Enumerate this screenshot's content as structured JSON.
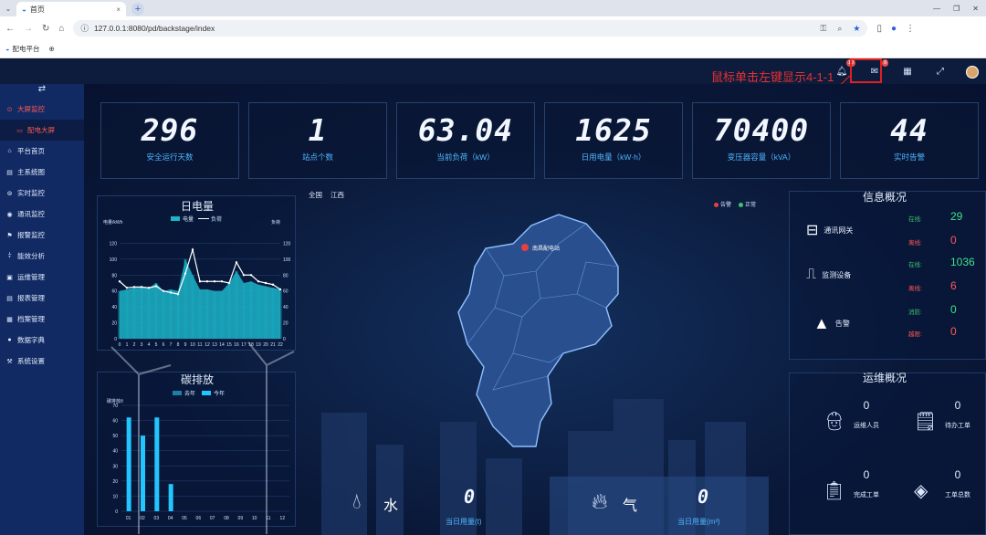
{
  "browser": {
    "tab_title": "首页",
    "url": "127.0.0.1:8080/pd/backstage/index",
    "bookmark": "配电平台"
  },
  "annotation": "鼠标单击左键显示4-1-1",
  "header": {
    "bell_badge": "10",
    "mail_badge": "9"
  },
  "sidebar": {
    "toggle": "⇄",
    "items": [
      {
        "label": "大屏监控",
        "icon": "monitor-icon"
      },
      {
        "label": "配电大屏",
        "icon": "screen-icon"
      },
      {
        "label": "平台首页",
        "icon": "home-icon"
      },
      {
        "label": "主系统图",
        "icon": "diagram-icon"
      },
      {
        "label": "实时监控",
        "icon": "pin-icon"
      },
      {
        "label": "通讯监控",
        "icon": "comm-icon"
      },
      {
        "label": "报警监控",
        "icon": "alarm-icon"
      },
      {
        "label": "能效分析",
        "icon": "energy-icon"
      },
      {
        "label": "运维管理",
        "icon": "ops-icon"
      },
      {
        "label": "报表管理",
        "icon": "report-icon"
      },
      {
        "label": "档案管理",
        "icon": "archive-icon"
      },
      {
        "label": "数据字典",
        "icon": "dict-icon"
      },
      {
        "label": "系统设置",
        "icon": "wrench-icon"
      }
    ]
  },
  "kpis": [
    {
      "value": "296",
      "label": "安全运行天数"
    },
    {
      "value": "1",
      "label": "站点个数"
    },
    {
      "value": "63.04",
      "label": "当前负荷（kW）"
    },
    {
      "value": "1625",
      "label": "日用电量（kW·h）"
    },
    {
      "value": "70400",
      "label": "变压器容量（kVA）"
    },
    {
      "value": "44",
      "label": "实时告警"
    }
  ],
  "map": {
    "region": "全国",
    "province": "江西",
    "legend_alarm": "告警",
    "legend_normal": "正常",
    "marker_label": "南昌配电站"
  },
  "info": {
    "title": "信息概况",
    "gateway": {
      "label": "通讯网关",
      "online_label": "在线:",
      "online": "29",
      "offline_label": "离线:",
      "offline": "0"
    },
    "device": {
      "label": "监测设备",
      "online_label": "在线:",
      "online": "1036",
      "offline_label": "离线:",
      "offline": "6"
    },
    "alarm": {
      "label": "告警",
      "unconfirmed_label": "消防:",
      "unconfirmed": "0",
      "over_label": "越限:",
      "over": "0"
    }
  },
  "ops": {
    "title": "运维概况",
    "items": [
      {
        "label": "运维人员",
        "value": "0"
      },
      {
        "label": "待办工单",
        "value": "0"
      },
      {
        "label": "完成工单",
        "value": "0"
      },
      {
        "label": "工单总数",
        "value": "0"
      }
    ]
  },
  "utility": {
    "water_label": "水",
    "water_value": "0",
    "water_caption": "当日用量(t)",
    "gas_label": "气",
    "gas_value": "0",
    "gas_caption": "当日用量(m³)"
  },
  "chart_data": [
    {
      "type": "area",
      "title": "日电量",
      "ylabel": "电量/kWh",
      "ylabel_right": "负荷",
      "ylim": [
        0,
        140
      ],
      "categories": [
        "0",
        "1",
        "2",
        "3",
        "4",
        "5",
        "6",
        "7",
        "8",
        "9",
        "10",
        "11",
        "12",
        "13",
        "14",
        "15",
        "16",
        "17",
        "18",
        "19",
        "20",
        "21",
        "22"
      ],
      "series": [
        {
          "name": "电量",
          "values": [
            60,
            62,
            64,
            66,
            64,
            70,
            60,
            62,
            60,
            100,
            80,
            62,
            62,
            60,
            60,
            70,
            85,
            70,
            72,
            68,
            66,
            64,
            62
          ]
        },
        {
          "name": "负荷",
          "values": [
            72,
            64,
            65,
            65,
            64,
            66,
            60,
            58,
            56,
            82,
            112,
            72,
            72,
            72,
            72,
            70,
            96,
            80,
            80,
            72,
            70,
            68,
            62
          ]
        }
      ]
    },
    {
      "type": "bar",
      "title": "碳排放",
      "ylabel": "碳排放/t",
      "ylim": [
        0,
        70
      ],
      "categories": [
        "01",
        "02",
        "03",
        "04",
        "05",
        "06",
        "07",
        "08",
        "09",
        "10",
        "11",
        "12"
      ],
      "series": [
        {
          "name": "去年",
          "values": [
            0,
            0,
            0,
            0,
            0,
            0,
            0,
            0,
            0,
            0,
            0,
            0
          ]
        },
        {
          "name": "今年",
          "values": [
            62,
            50,
            62,
            18,
            0,
            0,
            0,
            0,
            0,
            0,
            0,
            0
          ]
        }
      ]
    }
  ]
}
